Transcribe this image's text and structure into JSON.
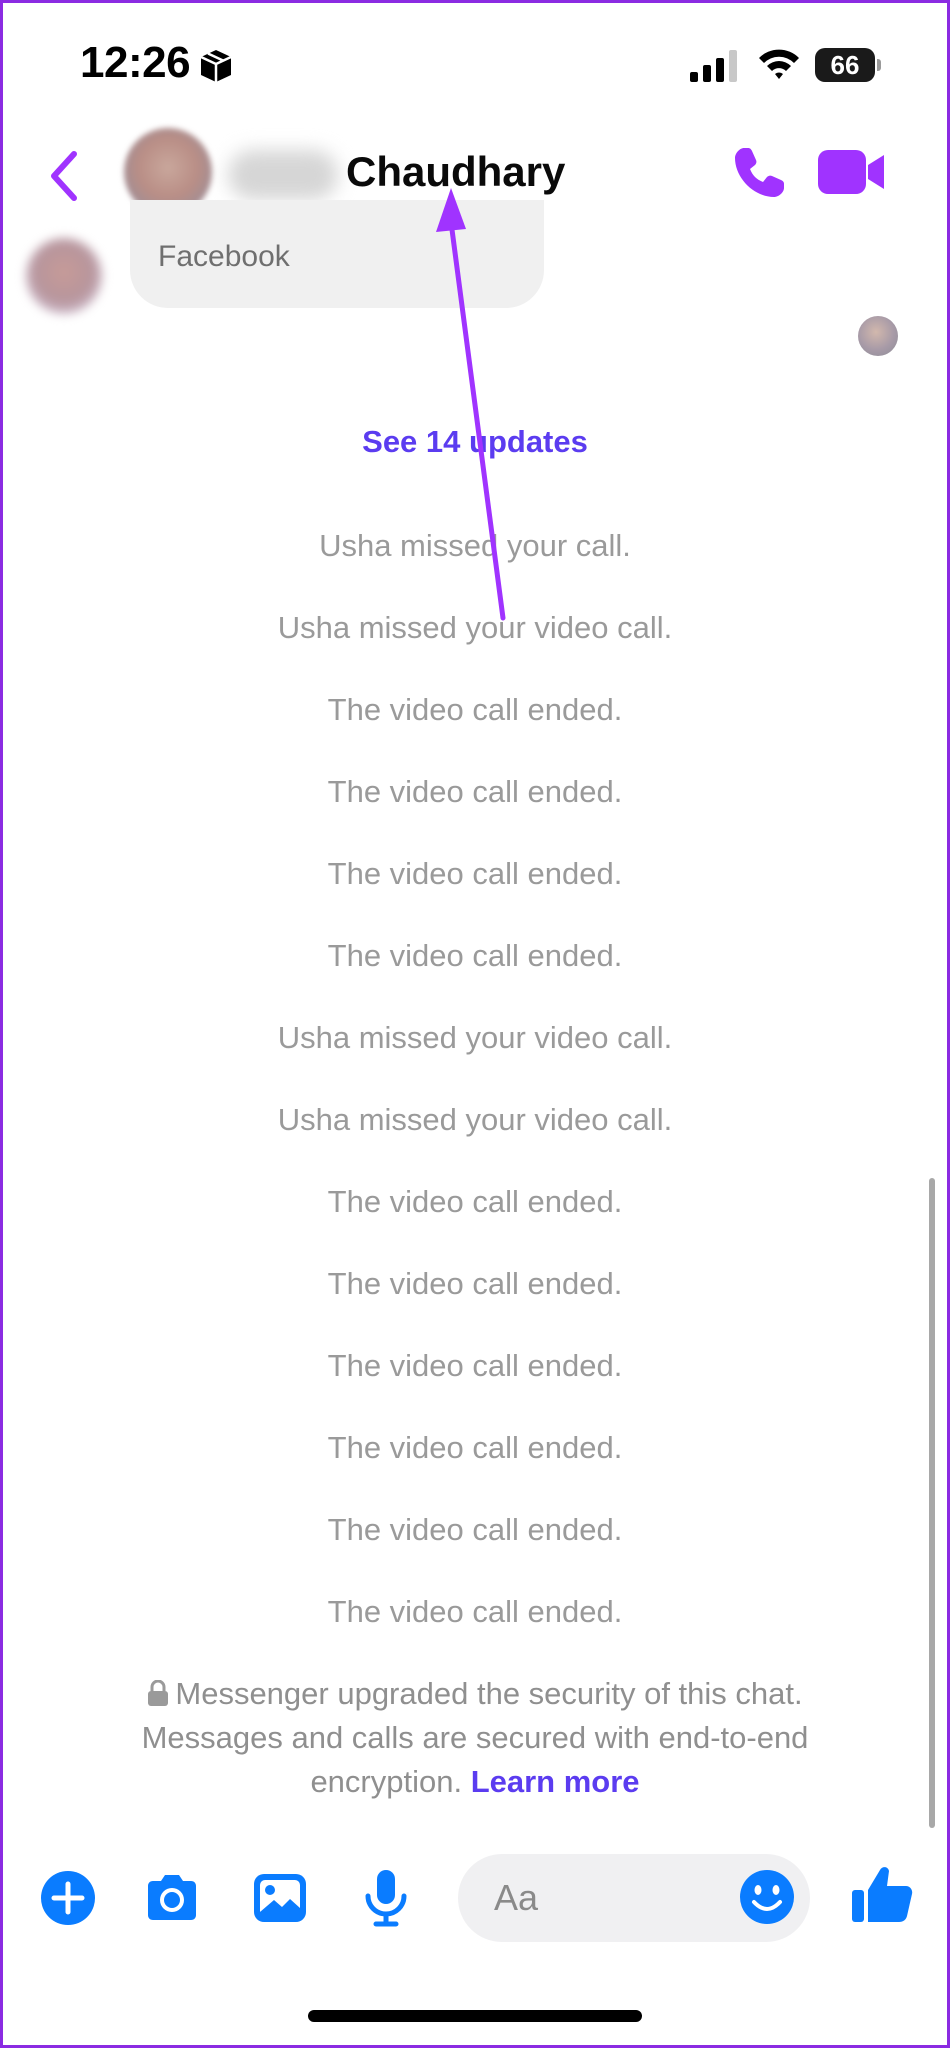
{
  "status_bar": {
    "time": "12:26",
    "battery": "66",
    "icons": [
      "box-icon",
      "cellular-signal-icon",
      "wifi-icon",
      "battery-icon"
    ]
  },
  "header": {
    "contact_name": "Chaudhary",
    "icons": [
      "chevron-left-icon",
      "phone-icon",
      "video-camera-icon"
    ]
  },
  "message_card": {
    "subtitle": "Facebook"
  },
  "updates": {
    "see_updates_label": "See 14 updates",
    "events": [
      "Usha missed your call.",
      "Usha missed your video call.",
      "The video call ended.",
      "The video call ended.",
      "The video call ended.",
      "The video call ended.",
      "Usha missed your video call.",
      "Usha missed your video call.",
      "The video call ended.",
      "The video call ended.",
      "The video call ended.",
      "The video call ended.",
      "The video call ended.",
      "The video call ended."
    ]
  },
  "security": {
    "line1": "Messenger upgraded the security of this chat.",
    "line2": "Messages and calls are secured with end-to-end",
    "line3": "encryption.",
    "learn_more": "Learn more"
  },
  "composer": {
    "placeholder": "Aa",
    "icons": [
      "plus-icon",
      "camera-icon",
      "gallery-icon",
      "microphone-icon",
      "emoji-icon",
      "thumbs-up-icon"
    ]
  },
  "colors": {
    "accent_purple": "#a033ff",
    "link_blue": "#5b3cf0",
    "composer_blue": "#0a7cff",
    "event_text_gray": "#9a9a9a",
    "annotation_frame": "#8b2be2"
  }
}
